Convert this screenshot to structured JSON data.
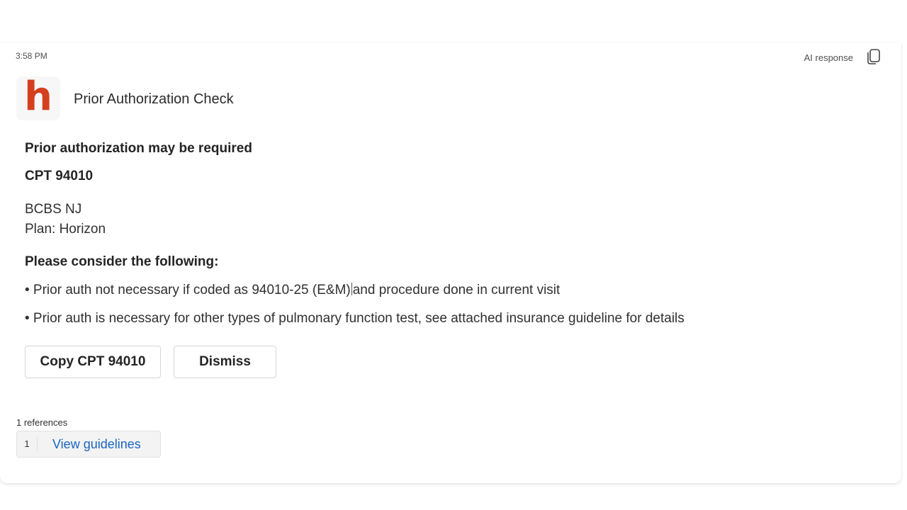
{
  "message": {
    "timestamp": "3:58 PM",
    "ai_label": "AI response",
    "app_logo_letter": "h",
    "card_title": "Prior Authorization Check"
  },
  "card": {
    "status_heading": "Prior authorization may be required",
    "cpt_heading": "CPT 94010",
    "insurer": "BCBS NJ",
    "plan": "Plan: Horizon",
    "consider_heading": "Please consider the following:",
    "bullets": [
      "• Prior auth not necessary if coded as 94010-25 (E&M)",
      "and procedure done in current visit",
      "• Prior auth is necessary for other types of pulmonary function test, see attached insurance guideline for details"
    ],
    "copy_button": "Copy CPT 94010",
    "dismiss_button": "Dismiss"
  },
  "references": {
    "label": "1 references",
    "items": [
      {
        "number": "1",
        "label": "View guidelines"
      }
    ]
  },
  "colors": {
    "logo": "#d4401e",
    "link": "#1a66c2"
  },
  "icons": {
    "copy": "copy-icon"
  }
}
